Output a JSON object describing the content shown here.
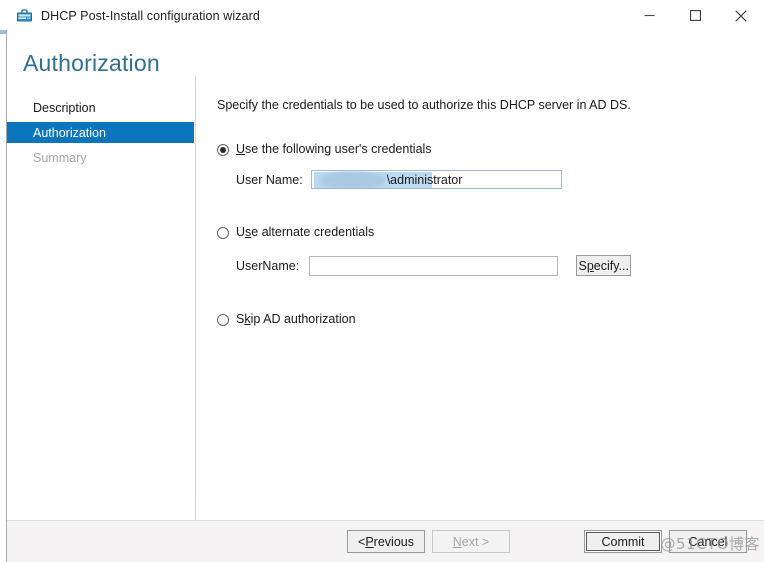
{
  "window": {
    "title": "DHCP Post-Install configuration wizard",
    "app_icon": "dhcp-server-icon",
    "controls": {
      "minimize": "minimize-icon",
      "maximize": "maximize-icon",
      "close": "close-icon"
    }
  },
  "page": {
    "heading": "Authorization",
    "heading_color": "#31708f"
  },
  "sidebar": {
    "items": [
      {
        "label": "Description",
        "state": "normal"
      },
      {
        "label": "Authorization",
        "state": "active"
      },
      {
        "label": "Summary",
        "state": "disabled"
      }
    ],
    "active_color": "#0d75bc"
  },
  "main": {
    "intro": "Specify the credentials to be used to authorize this DHCP server in AD DS.",
    "options": [
      {
        "label_pre": "U",
        "label_mnemonic": "",
        "label": "Use the following user's credentials",
        "selected": true
      },
      {
        "label": "Use alternate credentials",
        "selected": false
      },
      {
        "label": "Skip AD authorization",
        "selected": false
      }
    ],
    "option1": {
      "mn": "U",
      "rest": "se the following user's credentials",
      "field_label": "User Name:",
      "field_value": "\\administrator",
      "field_redacted": true,
      "field_selected": true
    },
    "option2": {
      "pre": "U",
      "mn": "s",
      "rest": "e alternate credentials",
      "field_label": "UserName:",
      "field_value": "",
      "field_placeholder": "",
      "specify_pre": "S",
      "specify_mn": "p",
      "specify_rest": "ecify..."
    },
    "option3": {
      "pre": "S",
      "mn": "k",
      "rest": "ip AD authorization"
    }
  },
  "footer": {
    "previous_pre": "< ",
    "previous_mn": "P",
    "previous_rest": "revious",
    "next_mn": "N",
    "next_rest": "ext >",
    "next_disabled": true,
    "commit": "Commit",
    "commit_focused": true,
    "cancel": "Cancel"
  },
  "watermark": {
    "text": "@51CTO博客"
  }
}
